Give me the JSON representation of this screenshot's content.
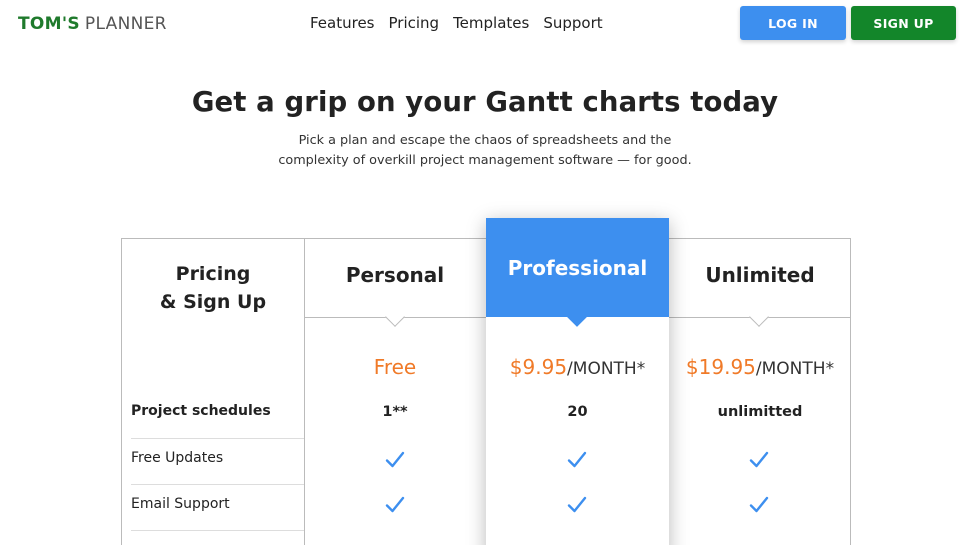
{
  "header": {
    "logo_bold": "TOM'S",
    "logo_light": "PLANNER",
    "nav": [
      "Features",
      "Pricing",
      "Templates",
      "Support"
    ],
    "login_label": "LOG IN",
    "signup_label": "SIGN UP"
  },
  "hero": {
    "title": "Get a grip on your Gantt charts today",
    "subtitle_line1": "Pick a plan and escape the chaos of spreadsheets and the",
    "subtitle_line2": "complexity of overkill project management software — for good."
  },
  "pricing": {
    "feature_header_line1": "Pricing",
    "feature_header_line2": "& Sign Up",
    "plans": [
      {
        "name": "Personal",
        "price": "Free",
        "period": ""
      },
      {
        "name": "Professional",
        "price": "$9.95",
        "period": "/MONTH*"
      },
      {
        "name": "Unlimited",
        "price": "$19.95",
        "period": "/MONTH*"
      }
    ],
    "features": [
      {
        "label": "Project schedules",
        "values": [
          "1**",
          "20",
          "unlimitted"
        ]
      },
      {
        "label": "Free Updates",
        "values": [
          "check-icon",
          "check-icon",
          "check-icon"
        ]
      },
      {
        "label": "Email Support",
        "values": [
          "check-icon",
          "check-icon",
          "check-icon"
        ]
      }
    ]
  },
  "colors": {
    "brand_green": "#1f7a2c",
    "accent_blue": "#3d8fef",
    "signup_green": "#13862a",
    "price_orange": "#f07a28"
  }
}
